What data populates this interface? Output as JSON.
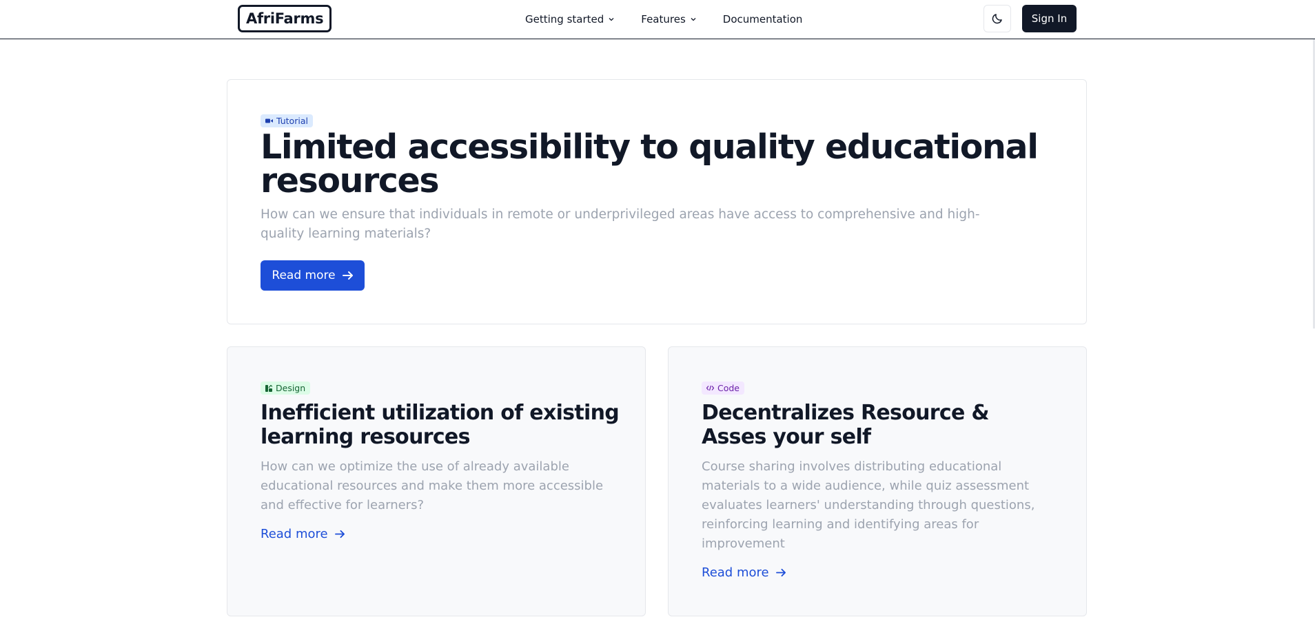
{
  "header": {
    "logo": "AfriFarms",
    "nav": {
      "getting_started": "Getting started",
      "features": "Features",
      "documentation": "Documentation"
    },
    "theme_icon": "moon-icon",
    "signin": "Sign In"
  },
  "hero": {
    "badge": "Tutorial",
    "badge_icon": "video-camera-icon",
    "title": "Limited accessibility to quality educational resources",
    "description": "How can we ensure that individuals in remote or underprivileged areas have access to comprehensive and high-quality learning materials?",
    "button": "Read more"
  },
  "cards": [
    {
      "badge": "Design",
      "badge_icon": "design-icon",
      "title": "Inefficient utilization of existing learning resources",
      "description": "How can we optimize the use of already available educational resources and make them more accessible and effective for learners?",
      "link": "Read more"
    },
    {
      "badge": "Code",
      "badge_icon": "code-icon",
      "title": "Decentralizes Resource & Asses your self",
      "description": "Course sharing involves distributing educational materials to a wide audience, while quiz assessment evaluates learners' understanding through questions, reinforcing learning and identifying areas for improvement",
      "link": "Read more"
    }
  ],
  "colors": {
    "primary": "#1d4ed8",
    "dark": "#111827",
    "muted_text": "#9ca3af",
    "card_bg": "#f8f9fb"
  }
}
